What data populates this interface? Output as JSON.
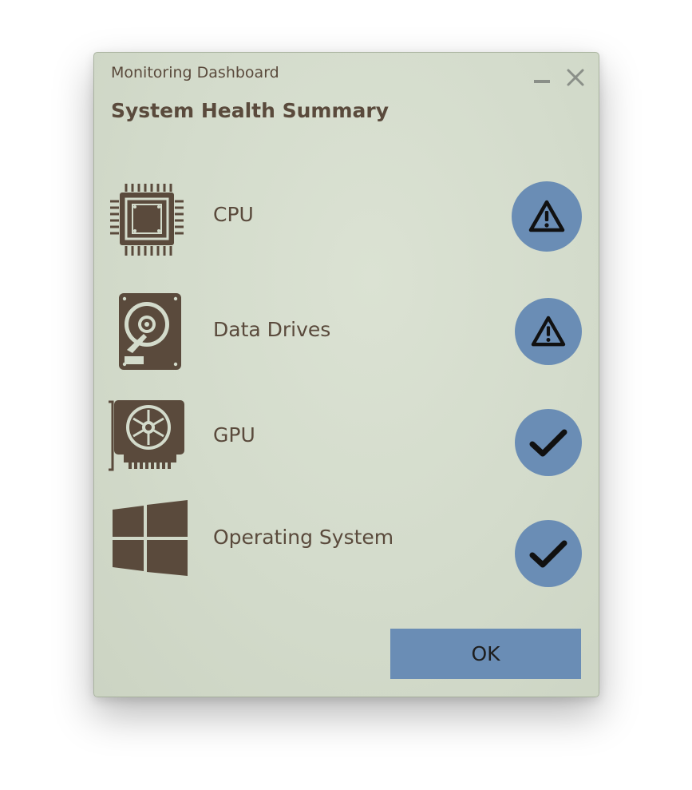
{
  "window": {
    "title": "Monitoring Dashboard",
    "minimize_icon": "minimize-icon",
    "close_icon": "close-icon"
  },
  "heading": "System Health Summary",
  "components": [
    {
      "label": "CPU",
      "icon": "cpu-icon",
      "status": "warning",
      "status_icon": "warning-icon"
    },
    {
      "label": "Data Drives",
      "icon": "hard-drive-icon",
      "status": "warning",
      "status_icon": "warning-icon"
    },
    {
      "label": "GPU",
      "icon": "gpu-icon",
      "status": "ok",
      "status_icon": "checkmark-icon"
    },
    {
      "label": "Operating System",
      "icon": "windows-logo-icon",
      "status": "ok",
      "status_icon": "checkmark-icon"
    }
  ],
  "ok_button": {
    "label": "OK"
  },
  "colors": {
    "dialog_background": "#d3dbcb",
    "text": "#5a4a3c",
    "icon_brown": "#5a4a3c",
    "status_badge": "#6a8db5",
    "button": "#6a8db5"
  }
}
